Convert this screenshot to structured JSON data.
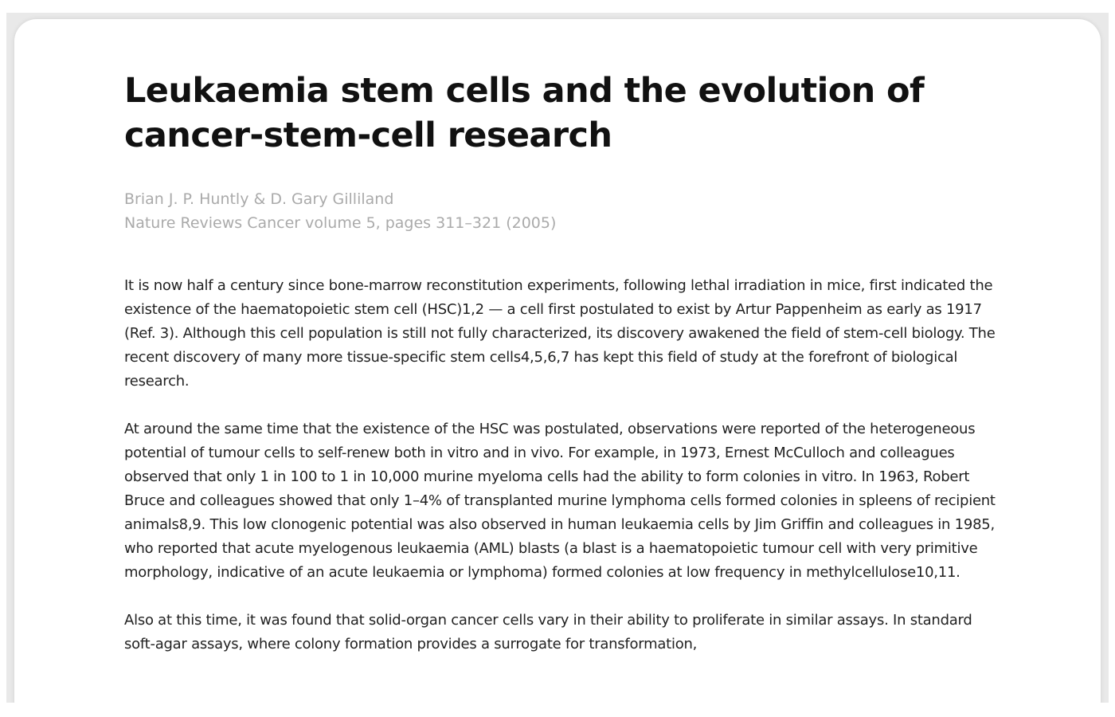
{
  "article": {
    "title": "Leukaemia stem cells and the evolution of cancer-stem-cell research",
    "authors": "Brian J. P. Huntly & D. Gary Gilliland",
    "citation": "Nature Reviews Cancer volume 5, pages 311–321 (2005)",
    "paragraphs": [
      "It is now half a century since bone-marrow reconstitution experiments, following lethal irradiation in mice, first indicated the existence of the haematopoietic stem cell (HSC)1,2 — a cell first postulated to exist by Artur Pappenheim as early as 1917 (Ref. 3). Although this cell population is still not fully characterized, its discovery awakened the field of stem-cell biology. The recent discovery of many more tissue-specific stem cells4,5,6,7 has kept this field of study at the forefront of biological research.",
      "At around the same time that the existence of the HSC was postulated, observations were reported of the heterogeneous potential of tumour cells to self-renew both in vitro and in vivo. For example, in 1973, Ernest McCulloch and colleagues observed that only 1 in 100 to 1 in 10,000 murine myeloma cells had the ability to form colonies in vitro. In 1963, Robert Bruce and colleagues showed that only 1–4% of transplanted murine lymphoma cells formed colonies in spleens of recipient animals8,9. This low clonogenic potential was also observed in human leukaemia cells by Jim Griffin and colleagues in 1985, who reported that acute myelogenous leukaemia (AML) blasts (a blast is a haematopoietic tumour cell with very primitive morphology, indicative of an acute leukaemia or lymphoma) formed colonies at low frequency in methylcellulose10,11.",
      "Also at this time, it was found that solid-organ cancer cells vary in their ability to proliferate in similar assays. In standard soft-agar assays, where colony formation provides a surrogate for transformation,"
    ]
  }
}
